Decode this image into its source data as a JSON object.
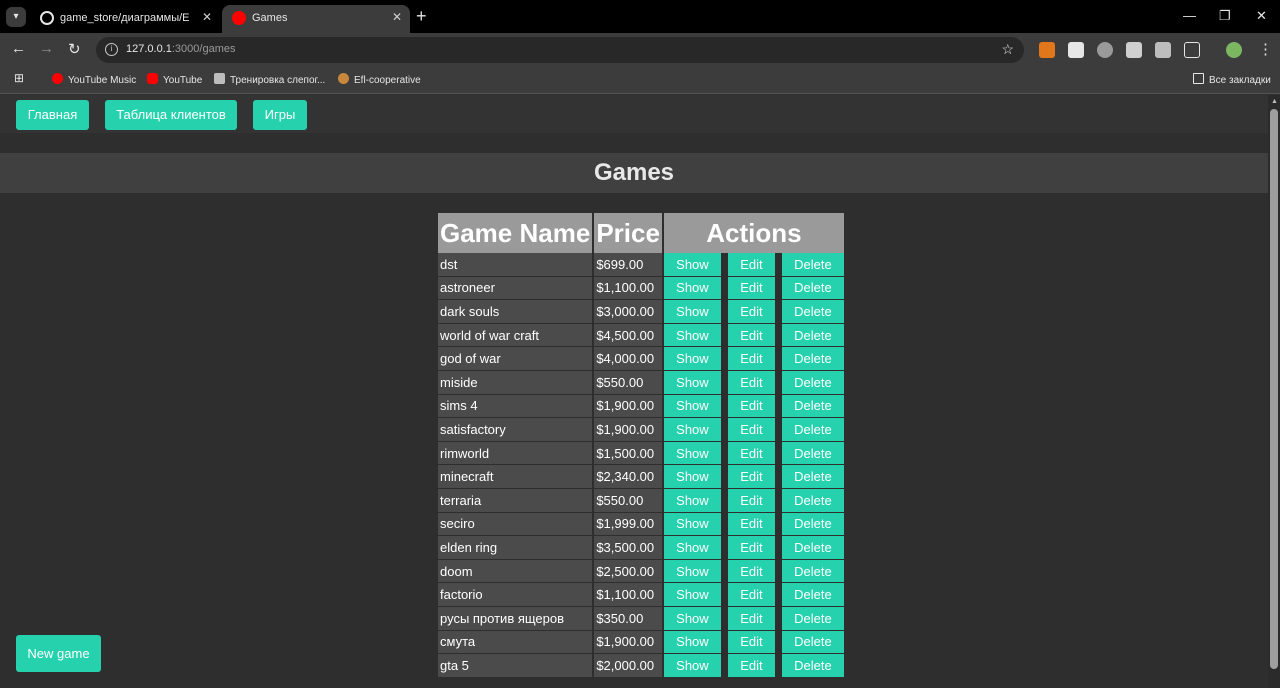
{
  "browser": {
    "tabs": [
      {
        "title": "game_store/диаграммы/ER_DI"
      },
      {
        "title": "Games"
      }
    ],
    "url_host": "127.0.0.1",
    "url_path": ":3000/games",
    "bookmarks": [
      "YouTube Music",
      "YouTube",
      "Тренировка слепог...",
      "Efl-cooperative"
    ],
    "all_bookmarks_label": "Все закладки"
  },
  "nav": {
    "home": "Главная",
    "clients": "Таблица клиентов",
    "games": "Игры"
  },
  "page_title": "Games",
  "table": {
    "headers": {
      "name": "Game Name",
      "price": "Price",
      "actions": "Actions"
    },
    "action_labels": {
      "show": "Show",
      "edit": "Edit",
      "delete": "Delete"
    },
    "rows": [
      {
        "name": "dst",
        "price": "$699.00"
      },
      {
        "name": "astroneer",
        "price": "$1,100.00"
      },
      {
        "name": "dark souls",
        "price": "$3,000.00"
      },
      {
        "name": "world of war craft",
        "price": "$4,500.00"
      },
      {
        "name": "god of war",
        "price": "$4,000.00"
      },
      {
        "name": "miside",
        "price": "$550.00"
      },
      {
        "name": "sims 4",
        "price": "$1,900.00"
      },
      {
        "name": "satisfactory",
        "price": "$1,900.00"
      },
      {
        "name": "rimworld",
        "price": "$1,500.00"
      },
      {
        "name": "minecraft",
        "price": "$2,340.00"
      },
      {
        "name": "terraria",
        "price": "$550.00"
      },
      {
        "name": "seciro",
        "price": "$1,999.00"
      },
      {
        "name": "elden ring",
        "price": "$3,500.00"
      },
      {
        "name": "doom",
        "price": "$2,500.00"
      },
      {
        "name": "factorio",
        "price": "$1,100.00"
      },
      {
        "name": "русы против ящеров",
        "price": "$350.00"
      },
      {
        "name": "смута",
        "price": "$1,900.00"
      },
      {
        "name": "gta 5",
        "price": "$2,000.00"
      }
    ]
  },
  "new_game_label": "New game"
}
